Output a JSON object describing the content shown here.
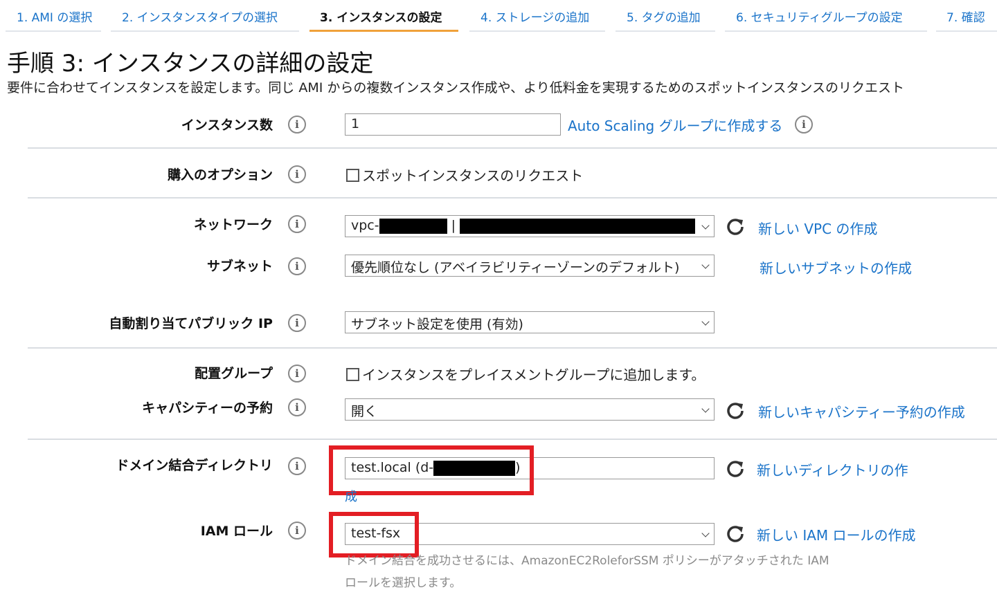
{
  "tabs": [
    {
      "label": "1. AMI の選択"
    },
    {
      "label": "2. インスタンスタイプの選択"
    },
    {
      "label": "3. インスタンスの設定"
    },
    {
      "label": "4. ストレージの追加"
    },
    {
      "label": "5. タグの追加"
    },
    {
      "label": "6. セキュリティグループの設定"
    },
    {
      "label": "7. 確認"
    }
  ],
  "page": {
    "title": "手順 3: インスタンスの詳細の設定",
    "description": "要件に合わせてインスタンスを設定します。同じ AMI からの複数インスタンス作成や、より低料金を実現するためのスポットインスタンスのリクエスト"
  },
  "fields": {
    "instance_count": {
      "label": "インスタンス数",
      "value": "1",
      "link": "Auto Scaling グループに作成する"
    },
    "purchase_option": {
      "label": "購入のオプション",
      "checkbox": "スポットインスタンスのリクエスト"
    },
    "network": {
      "label": "ネットワーク",
      "value_prefix": "vpc-",
      "value_sep": "|",
      "link": "新しい VPC の作成"
    },
    "subnet": {
      "label": "サブネット",
      "value": "優先順位なし (アベイラビリティーゾーンのデフォルト)",
      "link": "新しいサブネットの作成"
    },
    "public_ip": {
      "label": "自動割り当てパブリック IP",
      "value": "サブネット設定を使用 (有効)"
    },
    "placement": {
      "label": "配置グループ",
      "checkbox": "インスタンスをプレイスメントグループに追加します。"
    },
    "capacity": {
      "label": "キャパシティーの予約",
      "value": "開く",
      "link": "新しいキャパシティー予約の作成"
    },
    "domain_dir": {
      "label": "ドメイン結合ディレクトリ",
      "value_prefix": "test.local (d-",
      "value_suffix": ")",
      "link_line1": "新しいディレクトリの作",
      "link_line2": "成"
    },
    "iam_role": {
      "label": "IAM ロール",
      "value": "test-fsx",
      "link": "新しい IAM ロールの作成",
      "hint_line1": "ドメイン結合を成功させるには、AmazonEC2RoleforSSM ポリシーがアタッチされた IAM",
      "hint_line2": "ロールを選択します。"
    }
  },
  "icons": {
    "info": "i",
    "refresh": "refresh-icon"
  },
  "colors": {
    "link": "#1a73c9",
    "active_tab_underline": "#f0a13a",
    "highlight_box": "#e31e24"
  }
}
